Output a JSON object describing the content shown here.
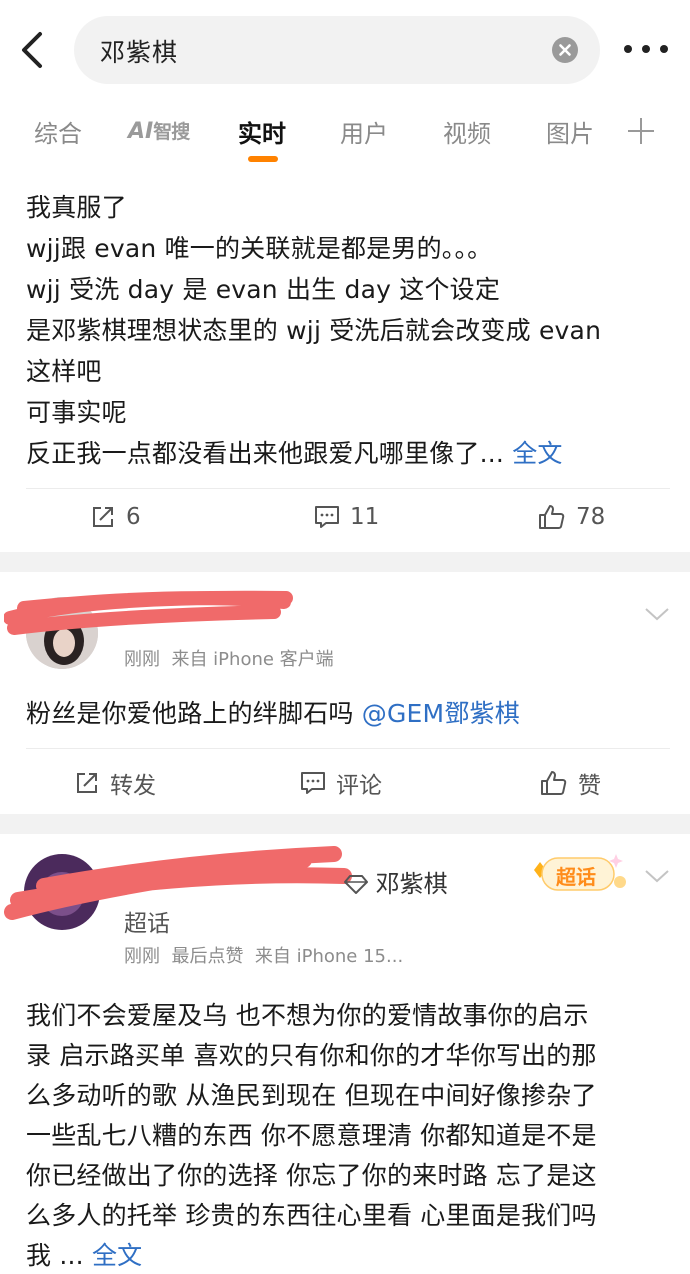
{
  "search": {
    "query": "邓紫棋"
  },
  "tabs": [
    {
      "label": "综合"
    },
    {
      "label": "AI",
      "sublabel": "智搜"
    },
    {
      "label": "实时"
    },
    {
      "label": "用户"
    },
    {
      "label": "视频"
    },
    {
      "label": "图片"
    }
  ],
  "post": {
    "lines": [
      "我真服了",
      "wjj跟 evan 唯一的关联就是都是男的。。。",
      "wjj 受洗 day 是 evan 出生 day 这个设定",
      "是邓紫棋理想状态里的 wjj 受洗后就会改变成 evan",
      "这样吧",
      "可事实呢",
      "反正我一点都没看出来他跟爱凡哪里像了..."
    ],
    "more_label": "全文",
    "reposts": "6",
    "comments": "11",
    "likes": "78"
  },
  "comment1": {
    "time": "刚刚",
    "source": "来自 iPhone 客户端",
    "text": "粉丝是你爱他路上的绊脚石吗 ",
    "mention": "@GEM鄧紫棋",
    "actions": {
      "repost": "转发",
      "comment": "评论",
      "like": "赞"
    }
  },
  "comment2": {
    "topic_name": "邓紫棋",
    "topic_suffix": "超话",
    "badge": "超话",
    "time": "刚刚",
    "liked": "最后点赞",
    "source": "来自 iPhone 15...",
    "lines": [
      "我们不会爱屋及乌 也不想为你的爱情故事你的启示",
      "录 启示路买单 喜欢的只有你和你的才华你写出的那",
      "么多动听的歌 从渔民到现在 但现在中间好像掺杂了",
      "一些乱七八糟的东西 你不愿意理清 你都知道是不是",
      "你已经做出了你的选择 你忘了你的来时路 忘了是这",
      "么多人的托举 珍贵的东西往心里看 心里面是我们吗",
      "我 ..."
    ],
    "more_label": "全文"
  },
  "colors": {
    "accent": "#ff8200",
    "link": "#2f6fc4",
    "redaction": "#f06a6a"
  },
  "icons": [
    "back-arrow-icon",
    "clear-icon",
    "more-icon",
    "plus-icon",
    "repost-icon",
    "comment-icon",
    "like-icon",
    "chevron-down-icon",
    "diamond-icon"
  ]
}
